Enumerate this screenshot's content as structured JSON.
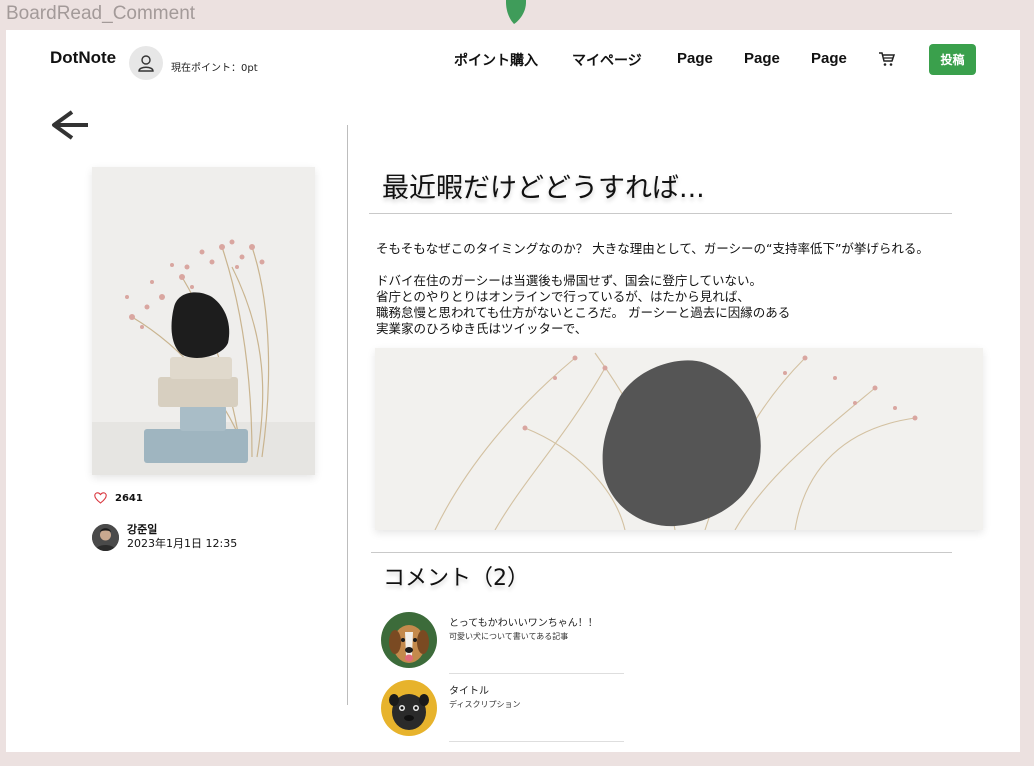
{
  "frame_label": "BoardRead_Comment",
  "header": {
    "logo": "DotNote",
    "points_label": "現在ポイント：0pt",
    "nav": [
      "ポイント購入",
      "マイページ",
      "Page",
      "Page",
      "Page"
    ],
    "post_button": "投稿"
  },
  "post": {
    "likes": "2641",
    "author_name": "강준일",
    "date": "2023年1月1日 12:35",
    "title": "最近暇だけどどうすれば...",
    "lead": "そもそもなぜこのタイミングなのか？ 大きな理由として、ガーシーの“支持率低下”が挙げられる。",
    "body_lines": [
      "ドバイ在住のガーシーは当選後も帰国せず、国会に登庁していない。",
      "省庁とのやりとりはオンラインで行っているが、はたから見れば、",
      "職務怠慢と思われても仕方がないところだ。 ガーシーと過去に因縁のある",
      "実業家のひろゆき氏はツイッターで、"
    ]
  },
  "comments": {
    "heading": "コメント（2）",
    "items": [
      {
        "title": "とってもかわいいワンちゃん！！",
        "description": "可愛い犬について書いてある記事"
      },
      {
        "title": "タイトル",
        "description": "ディスクリプション"
      }
    ]
  },
  "colors": {
    "accent": "#3aa04c",
    "background": "#ece1e0",
    "like_heart": "#d9363e"
  },
  "icons": {
    "user": "user-icon",
    "cart": "cart-icon",
    "back": "arrow-left-icon",
    "like": "heart-icon"
  }
}
